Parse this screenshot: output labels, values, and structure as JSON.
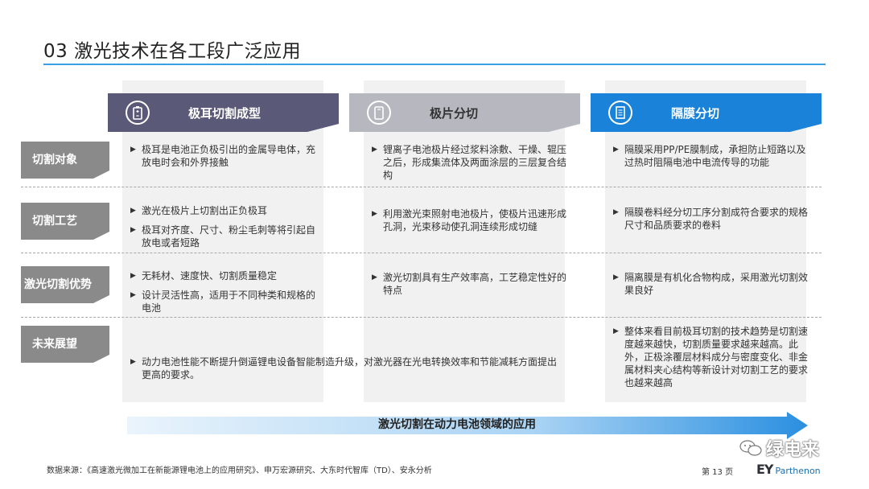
{
  "title": "03 激光技术在各工段广泛应用",
  "columns": [
    {
      "header": "极耳切割成型",
      "icon": "battery-icon",
      "color": "#5a5a78"
    },
    {
      "header": "极片分切",
      "icon": "battery-cell-icon",
      "color": "#b7b7bf"
    },
    {
      "header": "隔膜分切",
      "icon": "document-icon",
      "color": "#1a82d8"
    }
  ],
  "rows": [
    {
      "label": "切割对象",
      "cells": [
        [
          "极耳是电池正负极引出的金属导电体，充放电时会和外界接触"
        ],
        [
          "锂离子电池极片经过浆料涂敷、干燥、辊压之后，形成集流体及两面涂层的三层复合结构"
        ],
        [
          "隔膜采用PP/PE膜制成，承担防止短路以及过热时阻隔电池中电流传导的功能"
        ]
      ]
    },
    {
      "label": "切割工艺",
      "cells": [
        [
          "激光在极片上切割出正负极耳",
          "极耳对齐度、尺寸、粉尘毛刺等将引起自放电或者短路"
        ],
        [
          "利用激光束照射电池极片，使极片迅速形成孔洞，光束移动使孔洞连续形成切缝"
        ],
        [
          "隔膜卷料经分切工序分割成符合要求的规格尺寸和品质要求的卷料"
        ]
      ]
    },
    {
      "label": "激光切割优势",
      "cells": [
        [
          "无耗材、速度快、切割质量稳定",
          "设计灵活性高，适用于不同种类和规格的电池"
        ],
        [
          "激光切割具有生产效率高，工艺稳定性好的特点"
        ],
        [
          "隔离膜是有机化合物构成，采用激光切割效果良好"
        ]
      ]
    },
    {
      "label": "未来展望",
      "cells": [
        [
          "动力电池性能不断提升倒逼锂电设备智能制造升级，对激光器在光电转换效率和节能减耗方面提出更高的要求。"
        ],
        [
          "整体来看目前极耳切割的技术趋势是切割速度越来越快，切割质量要求越来越高。此外，正极涂覆层材料成分与密度变化、非金属材料夹心结构等新设计对切割工艺的要求也越来越高"
        ]
      ]
    }
  ],
  "arrow_label": "激光切割在动力电池领域的应用",
  "source": "数据来源：《高速激光微加工在新能源锂电池上的应用研究》、申万宏源研究、大东时代智库（TD）、安永分析",
  "page_number": "第 13 页",
  "watermark": "绿电来",
  "logo": {
    "ey": "EY",
    "partner": "Parthenon"
  },
  "colors": {
    "row_label": "#8a8a8a",
    "accent": "#3aa0e6",
    "arrow_light": "#eaf4fc",
    "arrow_dark": "#2a8fe0"
  }
}
